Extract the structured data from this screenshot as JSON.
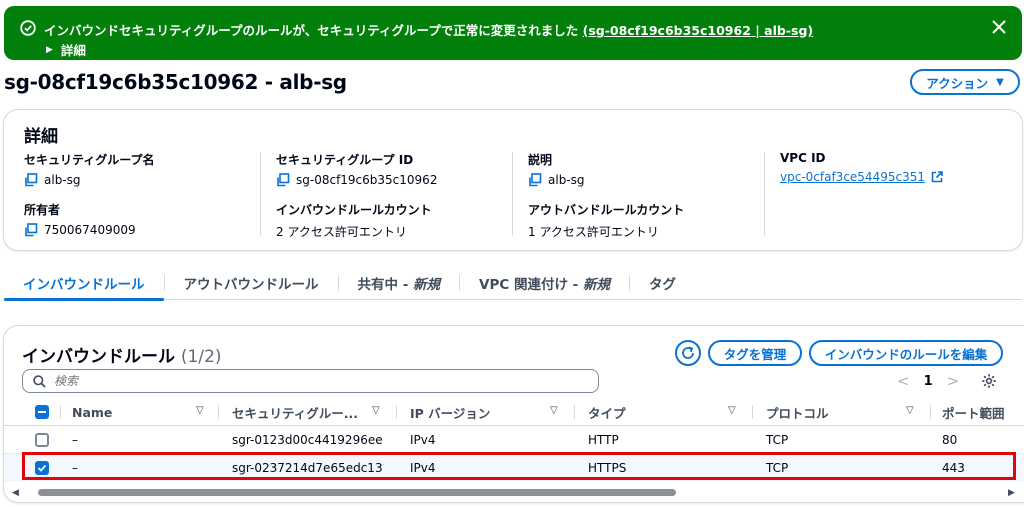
{
  "flash": {
    "message": "インバウンドセキュリティグループのルールが、セキュリティグループで正常に変更されました",
    "link": "(sg-08cf19c6b35c10962 | alb-sg)",
    "details": "詳細",
    "color": "#037f0c"
  },
  "header": {
    "title": "sg-08cf19c6b35c10962 - alb-sg",
    "actions_label": "アクション"
  },
  "details": {
    "heading": "詳細",
    "fields": [
      {
        "label": "セキュリティグループ名",
        "value": "alb-sg"
      },
      {
        "label": "セキュリティグループ ID",
        "value": "sg-08cf19c6b35c10962"
      },
      {
        "label": "説明",
        "value": "alb-sg"
      },
      {
        "label": "VPC ID",
        "value": "vpc-0cfaf3ce54495c351"
      },
      {
        "label": "所有者",
        "value": "750067409009"
      },
      {
        "label": "インバウンドルールカウント",
        "value": "2 アクセス許可エントリ"
      },
      {
        "label": "アウトバンドルールカウント",
        "value": "1 アクセス許可エントリ"
      }
    ]
  },
  "tabs": [
    {
      "label": "インバウンドルール",
      "suffix": ""
    },
    {
      "label": "アウトバウンドルール",
      "suffix": ""
    },
    {
      "label": "共有中 - ",
      "suffix": "新規"
    },
    {
      "label": "VPC 関連付け - ",
      "suffix": "新規"
    },
    {
      "label": "タグ",
      "suffix": ""
    }
  ],
  "rules": {
    "heading": "インバウンドルール",
    "count": "(1/2)",
    "manage_tags_label": "タグを管理",
    "edit_rules_label": "インバウンドのルールを編集",
    "search_placeholder": "検索",
    "page": "1",
    "columns": [
      "Name",
      "セキュリティグルー...",
      "IP バージョン",
      "タイプ",
      "プロトコル",
      "ポート範囲"
    ],
    "rows": [
      {
        "selected": false,
        "name": "–",
        "rule_id": "sgr-0123d00c4419296ee",
        "ip_version": "IPv4",
        "type": "HTTP",
        "protocol": "TCP",
        "port": "80"
      },
      {
        "selected": true,
        "name": "–",
        "rule_id": "sgr-0237214d7e65edc13",
        "ip_version": "IPv4",
        "type": "HTTPS",
        "protocol": "TCP",
        "port": "443"
      }
    ]
  },
  "colors": {
    "accent": "#0972d3",
    "highlight": "#e0050b"
  }
}
